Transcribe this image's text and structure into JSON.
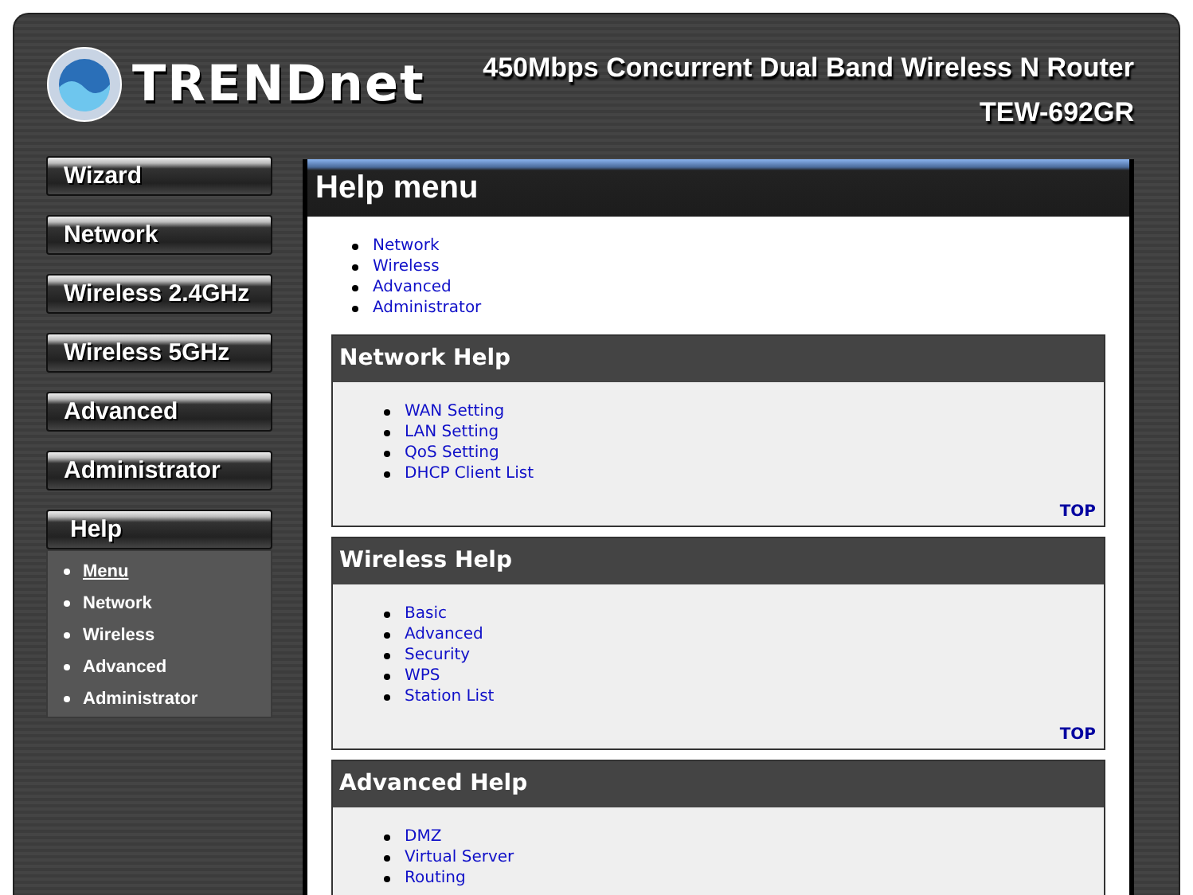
{
  "header": {
    "brand": "TRENDnet",
    "product": "450Mbps Concurrent Dual Band Wireless N Router",
    "model": "TEW-692GR"
  },
  "sidebar": {
    "items": [
      {
        "label": "Wizard",
        "expanded": false
      },
      {
        "label": "Network",
        "expanded": false
      },
      {
        "label": "Wireless 2.4GHz",
        "expanded": false
      },
      {
        "label": "Wireless 5GHz",
        "expanded": false
      },
      {
        "label": "Advanced",
        "expanded": false
      },
      {
        "label": "Administrator",
        "expanded": false
      },
      {
        "label": "Help",
        "expanded": true,
        "children": [
          {
            "label": "Menu",
            "selected": true
          },
          {
            "label": "Network",
            "selected": false
          },
          {
            "label": "Wireless",
            "selected": false
          },
          {
            "label": "Advanced",
            "selected": false
          },
          {
            "label": "Administrator",
            "selected": false
          }
        ]
      }
    ]
  },
  "content": {
    "title": "Help menu",
    "links": [
      "Network",
      "Wireless",
      "Advanced",
      "Administrator"
    ],
    "sections": [
      {
        "title": "Network Help",
        "links": [
          "WAN Setting",
          "LAN Setting",
          "QoS Setting",
          "DHCP Client List"
        ],
        "top_link": "TOP"
      },
      {
        "title": "Wireless Help",
        "links": [
          "Basic",
          "Advanced",
          "Security",
          "WPS",
          "Station List"
        ],
        "top_link": "TOP"
      },
      {
        "title": "Advanced Help",
        "links": [
          "DMZ",
          "Virtual Server",
          "Routing"
        ]
      }
    ]
  }
}
